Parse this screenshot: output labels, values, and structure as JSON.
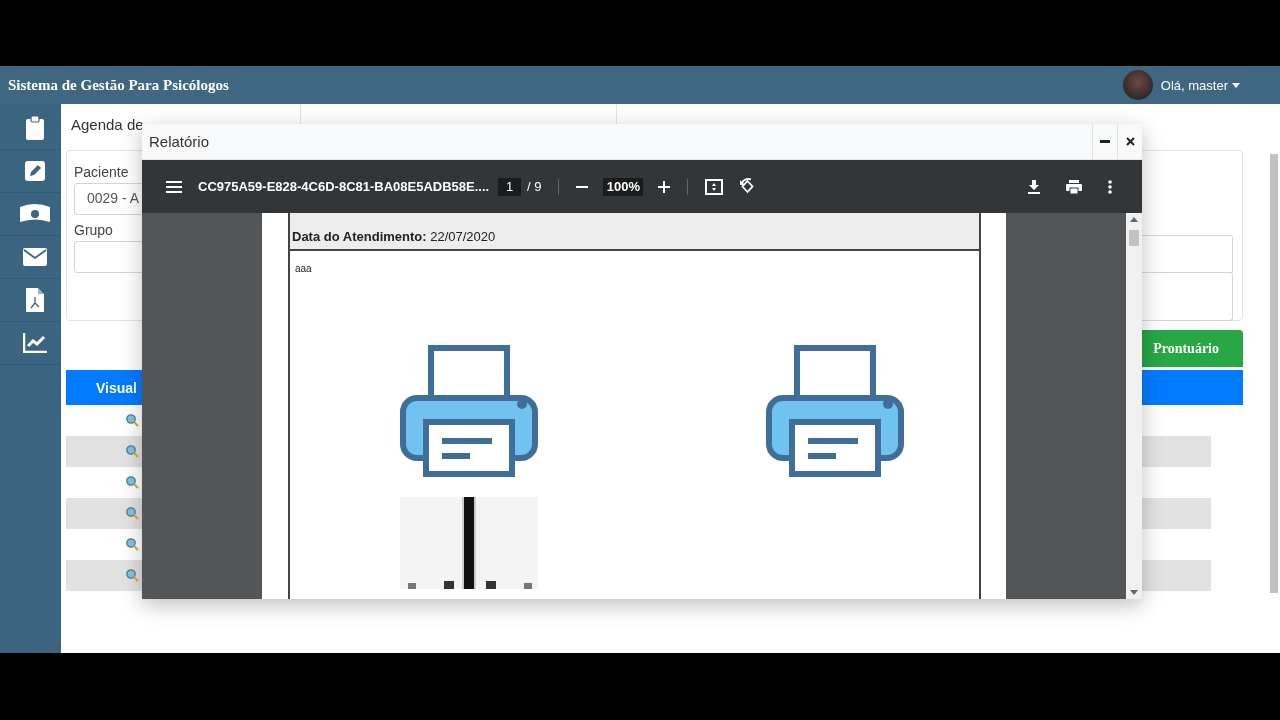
{
  "app": {
    "title": "Sistema de Gestão Para Psicólogos",
    "user": {
      "greeting": "Olá, master"
    }
  },
  "tabs": [
    {
      "label": "Agenda de"
    }
  ],
  "form": {
    "fields": [
      {
        "label": "Paciente",
        "value": "0029 - A"
      },
      {
        "label": "Grupo"
      }
    ]
  },
  "buttons": [
    {
      "label": "Prontuário",
      "kind": "success"
    }
  ],
  "table": {
    "header": "Visual"
  },
  "modal": {
    "title": "Relatório",
    "viewer": {
      "filename": "CC975A59-E828-4C6D-8C81-BA08E5ADB58E....",
      "page": "1",
      "page_count": "/ 9",
      "zoom": "100%"
    },
    "document": {
      "header_lines": [
        "**Data do Atendimento:**  22/07/2020"
      ],
      "note": "aaa"
    }
  }
}
